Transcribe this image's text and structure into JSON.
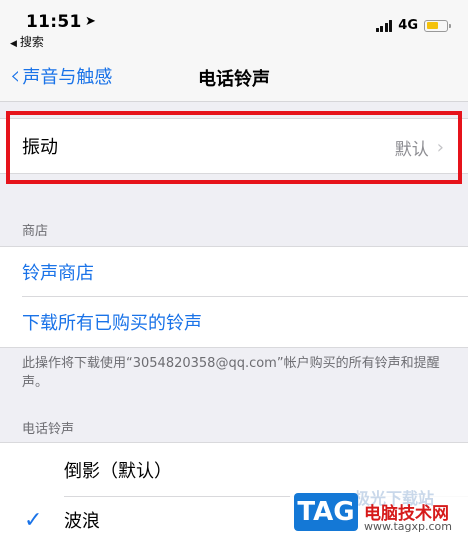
{
  "status_bar": {
    "time": "11:51",
    "location_icon": "location-arrow-icon",
    "back_app": "搜索",
    "network": "4G",
    "battery_color": "#f4c20d"
  },
  "nav": {
    "back_label": "声音与触感",
    "title": "电话铃声"
  },
  "vibration": {
    "label": "振动",
    "value": "默认"
  },
  "store_section": {
    "header": "商店",
    "items": [
      "铃声商店",
      "下载所有已购买的铃声"
    ],
    "footer": "此操作将下载使用“3054820358@qq.com”帐户购买的所有铃声和提醒声。"
  },
  "ringtone_section": {
    "header": "电话铃声",
    "items": [
      {
        "label": "倒影（默认）",
        "selected": false
      },
      {
        "label": "波浪",
        "selected": true
      }
    ]
  },
  "watermark": {
    "badge": "TAG",
    "ghost": "极光下载站",
    "name": "电脑技术网",
    "url": "www.tagxp.com"
  },
  "colors": {
    "accent": "#1a73e8",
    "highlight": "#e6131b",
    "background": "#efeff4"
  }
}
